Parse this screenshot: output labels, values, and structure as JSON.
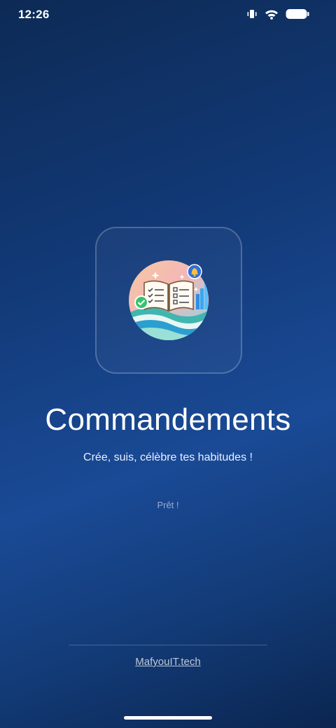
{
  "status_bar": {
    "time": "12:26",
    "icons": [
      "vibrate-icon",
      "wifi-icon",
      "battery-icon"
    ]
  },
  "splash": {
    "logo_icon": "open-book-habits-icon",
    "title": "Commandements",
    "tagline": "Crée, suis, célèbre tes habitudes !",
    "status": "Prêt !"
  },
  "footer": {
    "link_text": "MafyouIT.tech"
  },
  "colors": {
    "background_top": "#0d2a55",
    "background_mid": "#1a4a96",
    "background_bottom": "#0b2550",
    "text": "#ffffff"
  }
}
